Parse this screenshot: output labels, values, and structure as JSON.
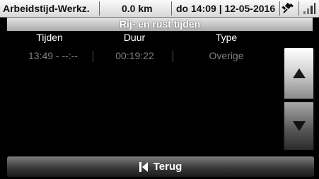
{
  "status_bar": {
    "mode": "Arbeidstijd-Werkz.",
    "distance": "0.0 km",
    "datetime": "do 14:09 | 12-05-2016"
  },
  "screen": {
    "title": "Rij- en rust tijden",
    "columns": [
      "Tijden",
      "Duur",
      "Type"
    ],
    "rows": [
      {
        "time": "13:49 - --:--",
        "duration": "00:19:22",
        "type": "Overige"
      }
    ]
  },
  "back_button": {
    "label": "Terug"
  },
  "colors": {
    "accent_text": "#ffffff",
    "row_text": "#808080",
    "background": "#000000"
  },
  "icons": [
    "gps-satellite-icon",
    "signal-strength-icon",
    "arrow-up-icon",
    "arrow-down-icon",
    "back-arrow-icon"
  ]
}
